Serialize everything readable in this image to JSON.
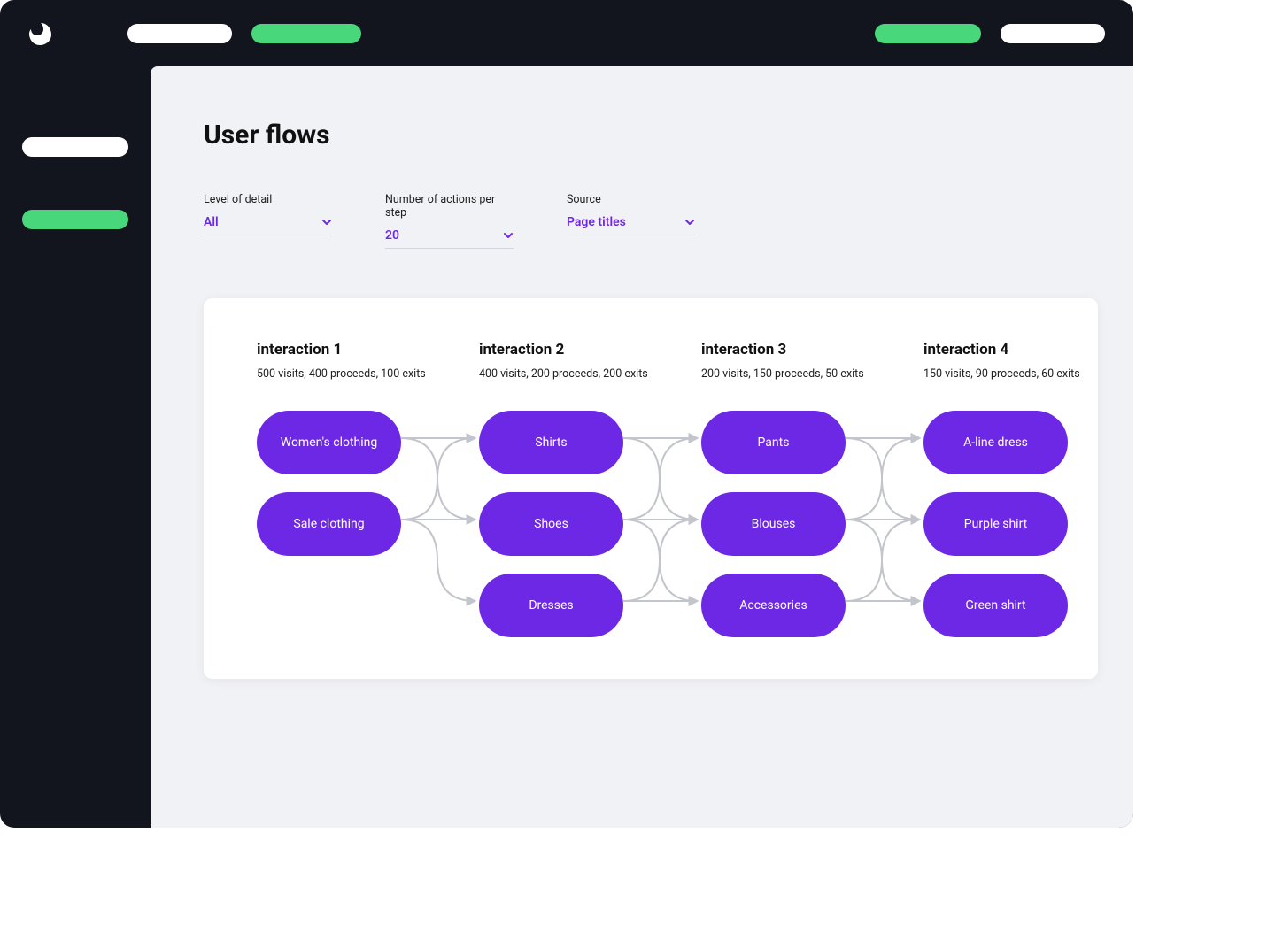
{
  "colors": {
    "accent": "#6d28e5",
    "green": "#48d77a",
    "dark": "#13151e",
    "panel": "#f1f2f6"
  },
  "page": {
    "title": "User flows"
  },
  "filters": [
    {
      "label": "Level of detail",
      "value": "All"
    },
    {
      "label": "Number of actions per step",
      "value": "20"
    },
    {
      "label": "Source",
      "value": "Page titles"
    }
  ],
  "flow": {
    "columns": [
      {
        "title": "interaction 1",
        "visits": 500,
        "proceeds": 400,
        "exits": 100,
        "sub": "500 visits, 400 proceeds, 100 exits",
        "nodes": [
          "Women's clothing",
          "Sale clothing"
        ]
      },
      {
        "title": "interaction 2",
        "visits": 400,
        "proceeds": 200,
        "exits": 200,
        "sub": "400 visits, 200 proceeds, 200 exits",
        "nodes": [
          "Shirts",
          "Shoes",
          "Dresses"
        ]
      },
      {
        "title": "interaction 3",
        "visits": 200,
        "proceeds": 150,
        "exits": 50,
        "sub": "200 visits, 150 proceeds, 50 exits",
        "nodes": [
          "Pants",
          "Blouses",
          "Accessories"
        ]
      },
      {
        "title": "interaction 4",
        "visits": 150,
        "proceeds": 90,
        "exits": 60,
        "sub": "150 visits, 90 proceeds, 60 exits",
        "nodes": [
          "A-line dress",
          "Purple shirt",
          "Green shirt"
        ]
      }
    ]
  }
}
